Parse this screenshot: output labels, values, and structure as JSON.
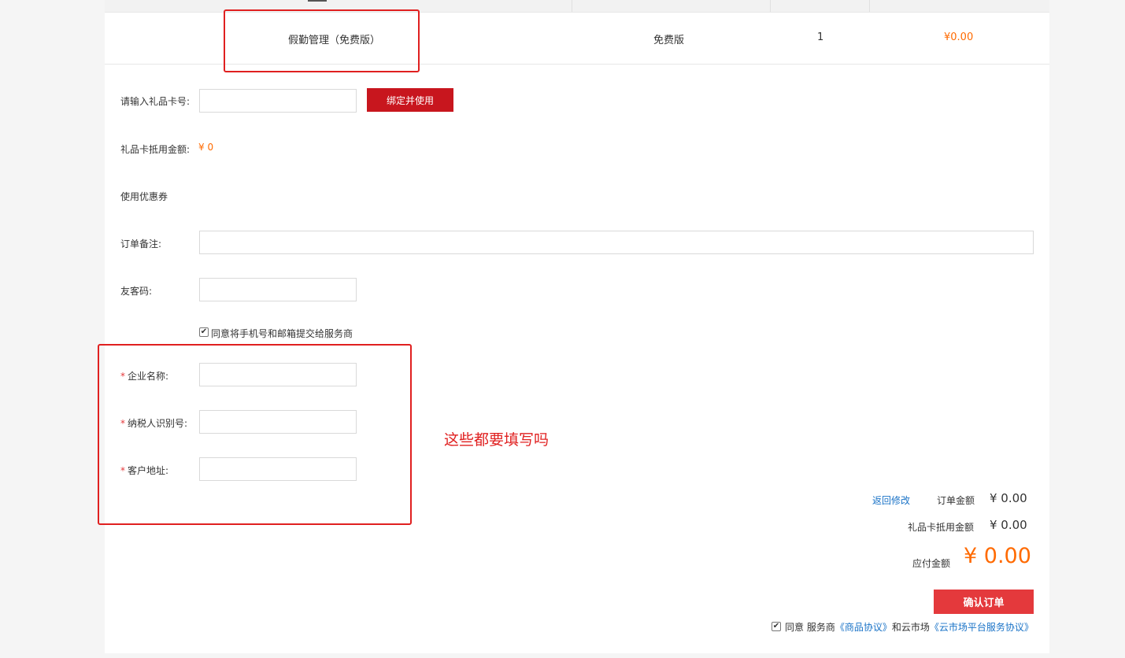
{
  "product_row": {
    "name": "假勤管理（免费版）",
    "edition": "免费版",
    "quantity": "1",
    "price": "¥0.00"
  },
  "form": {
    "gift_card_label": "请输入礼品卡号:",
    "gift_card_value": "",
    "bind_button": "绑定并使用",
    "gift_deduct_label": "礼品卡抵用金额:",
    "gift_deduct_value": "¥ 0",
    "coupon_label": "使用优惠券",
    "order_note_label": "订单备注:",
    "order_note_value": "",
    "referral_label": "友客码:",
    "referral_value": "",
    "consent_text": "同意将手机号和邮箱提交给服务商",
    "consent_checked": true,
    "required_mark": "*",
    "company_name_label": "企业名称:",
    "company_name_value": "",
    "tax_id_label": "纳税人识别号:",
    "tax_id_value": "",
    "address_label": "客户地址:",
    "address_value": ""
  },
  "annotation": {
    "text": "这些都要填写吗",
    "color": "#e02020"
  },
  "summary": {
    "back_link": "返回修改",
    "order_amount_label": "订单金额",
    "order_amount_value": "¥ 0.00",
    "gift_deduct_label": "礼品卡抵用金额",
    "gift_deduct_value": "¥ 0.00",
    "payable_label": "应付金额",
    "payable_value": "¥ 0.00",
    "confirm_button": "确认订单",
    "agree_prefix": "同意 服务商",
    "agreement_product": "《商品协议》",
    "agree_middle": "和云市场",
    "agreement_platform": "《云市场平台服务协议》",
    "agree_checked": true
  },
  "colors": {
    "accent_price": "#ff6a00",
    "bind_button": "#c8161e",
    "confirm_button": "#e4393c",
    "link": "#1a73c7"
  }
}
